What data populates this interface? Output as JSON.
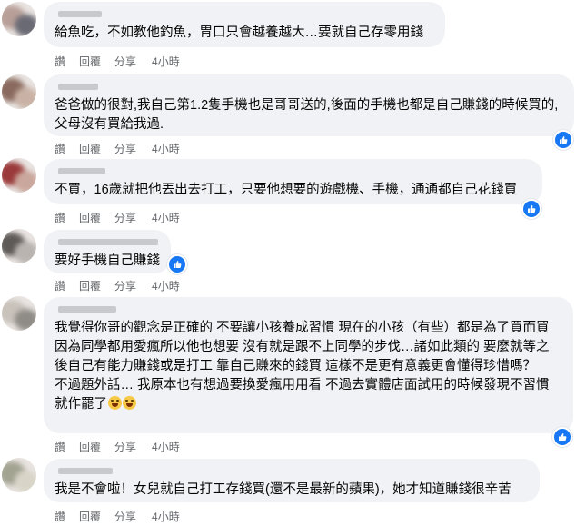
{
  "comments": [
    {
      "text": "給魚吃，不如教他釣魚，胃口只會越養越大…要就自己存零用錢",
      "actions": {
        "like": "讚",
        "reply": "回覆",
        "share": "分享",
        "time": "4小時"
      },
      "has_like_badge": false
    },
    {
      "text": "爸爸做的很對,我自己第1.2隻手機也是哥哥送的,後面的手機也都是自己賺錢的時候買的,父母沒有買給我過.",
      "actions": {
        "like": "讚",
        "reply": "回覆",
        "share": "分享",
        "time": "4小時"
      },
      "has_like_badge": true
    },
    {
      "text": "不買，16歲就把他丟出去打工，只要他想要的遊戲機、手機，通通都自己花錢買",
      "actions": {
        "like": "讚",
        "reply": "回覆",
        "share": "分享",
        "time": "4小時"
      },
      "has_like_badge": true
    },
    {
      "text": "要好手機自己賺錢",
      "actions": {
        "like": "讚",
        "reply": "回覆",
        "share": "分享",
        "time": "4小時"
      },
      "has_like_badge": true
    },
    {
      "text": "我覺得你哥的觀念是正確的 不要讓小孩養成習慣 現在的小孩（有些）都是為了買而買 因為同學都用愛瘋所以他也想要 沒有就是跟不上同學的步伐…諸如此類的 要麼就等之後自己有能力賺錢或是打工 靠自己賺來的錢買 這樣不是更有意義更會懂得珍惜嗎？",
      "text2": "不過題外話… 我原本也有想過要換愛瘋用用看 不過去實體店面試用的時候發現不習慣就作罷了",
      "actions": {
        "like": "讚",
        "reply": "回覆",
        "share": "分享",
        "time": "4小時"
      },
      "has_like_badge": true
    },
    {
      "text": "我是不會啦！女兒就自己打工存錢買(還不是最新的蘋果)，她才知道賺錢很辛苦",
      "actions": {
        "like": "讚",
        "reply": "回覆",
        "share": "分享",
        "time": "4小時"
      },
      "has_like_badge": false
    }
  ],
  "colors": {
    "bubble": "#f0f2f5",
    "meta_text": "#65676b",
    "like_blue": "#1877f2"
  },
  "icons": {
    "like_badge": "thumbs-up-icon",
    "emoji": "grinning-tears-emoji-icon"
  }
}
